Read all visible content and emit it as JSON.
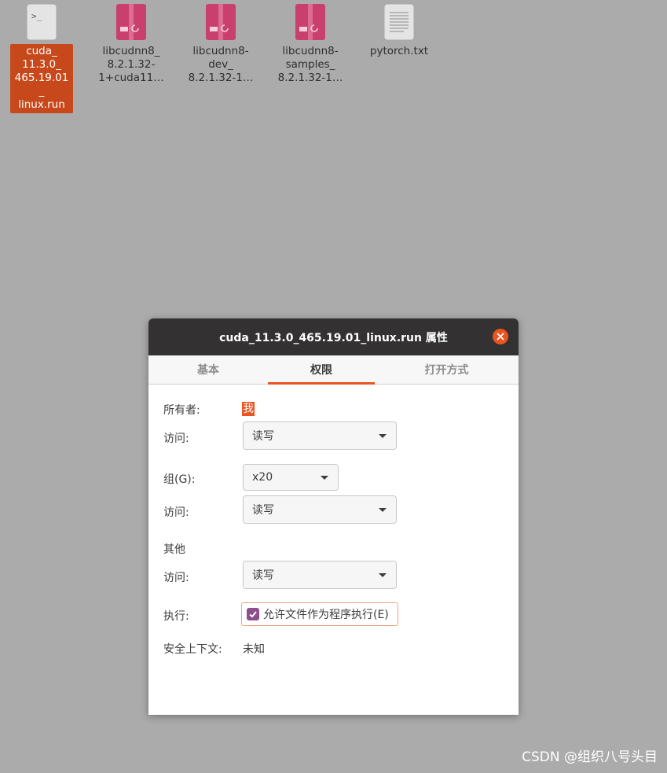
{
  "desktop": {
    "icons": [
      {
        "label": "cuda_\n11.3.0_\n465.19.01_\nlinux.run",
        "type": "terminal-script-icon",
        "selected": true
      },
      {
        "label": "libcudnn8_\n8.2.1.32-\n1+cuda11…",
        "type": "debian-package-icon",
        "selected": false
      },
      {
        "label": "libcudnn8-\ndev_\n8.2.1.32-1…",
        "type": "debian-package-icon",
        "selected": false
      },
      {
        "label": "libcudnn8-\nsamples_\n8.2.1.32-1…",
        "type": "debian-package-icon",
        "selected": false
      },
      {
        "label": "pytorch.txt",
        "type": "text-file-icon",
        "selected": false
      }
    ]
  },
  "dialog": {
    "title": "cuda_11.3.0_465.19.01_linux.run 属性",
    "tabs": [
      {
        "label": "基本",
        "active": false
      },
      {
        "label": "权限",
        "active": true
      },
      {
        "label": "打开方式",
        "active": false
      }
    ],
    "owner": {
      "label": "所有者:",
      "value": "我"
    },
    "owner_access": {
      "label": "访问:",
      "value": "读写"
    },
    "group": {
      "label": "组(G):",
      "value": "x20"
    },
    "group_access": {
      "label": "访问:",
      "value": "读写"
    },
    "others": {
      "heading": "其他"
    },
    "others_access": {
      "label": "访问:",
      "value": "读写"
    },
    "execute": {
      "label": "执行:",
      "checkbox_label": "允许文件作为程序执行(E)",
      "checked": true
    },
    "security_context": {
      "label": "安全上下文:",
      "value": "未知"
    }
  },
  "watermark": "CSDN @组织八号头目",
  "colors": {
    "accent": "#e95420",
    "selection": "#c7491b",
    "titlebar": "#333131",
    "checkbox": "#8b4f8c",
    "desktop_bg": "#ababab"
  }
}
